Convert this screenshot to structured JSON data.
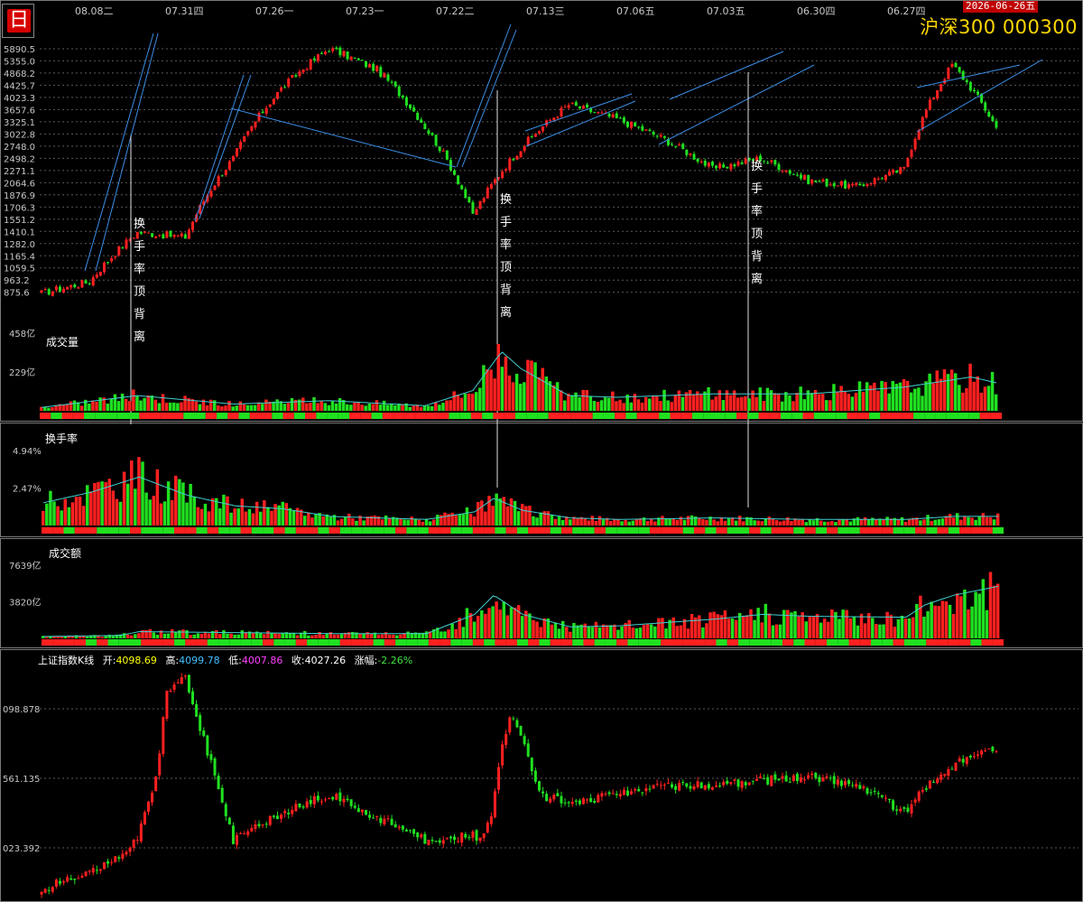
{
  "header": {
    "period_button": "日",
    "title": "沪深300  000300",
    "date_badge": "2026-06-26五"
  },
  "colors": {
    "up": "#ff2020",
    "down": "#20e020",
    "title": "#ffd700",
    "trendline": "#3a8ee6",
    "axis_text": "#c8c8c8",
    "grid": "#5a5a5a"
  },
  "top_dates": [
    "08.08二",
    "07.31四",
    "07.26一",
    "07.23一",
    "07.22二",
    "07.13三",
    "07.06五",
    "07.03五",
    "06.30四",
    "06.27四"
  ],
  "chart_data": [
    {
      "type": "line",
      "name": "price-panel",
      "yscale": "log",
      "ylabels": [
        "5890.5",
        "5355.0",
        "4868.2",
        "4425.7",
        "4023.3",
        "3657.6",
        "3325.1",
        "3022.8",
        "2748.0",
        "2498.2",
        "2271.1",
        "2064.6",
        "1876.9",
        "1706.3",
        "1551.2",
        "1410.1",
        "1282.0",
        "1165.4",
        "1059.5",
        "963.2",
        "875.6"
      ],
      "ylim": [
        820,
        6100
      ],
      "x": [
        0,
        5,
        10,
        15,
        20,
        25,
        30,
        35,
        40,
        45,
        50,
        55,
        60,
        65,
        70,
        75,
        80,
        85,
        90,
        95,
        100
      ],
      "values": [
        870,
        950,
        1400,
        1350,
        2500,
        4300,
        5900,
        5000,
        3200,
        1600,
        2700,
        3800,
        3400,
        2900,
        2300,
        2500,
        2100,
        2000,
        2300,
        5200,
        3000
      ],
      "annotations": [
        "换手率顶背离",
        "换手率顶背离",
        "换手率顶背离"
      ]
    },
    {
      "type": "bar",
      "name": "volume-panel",
      "title": "成交量",
      "ylabels": [
        "458亿",
        "229亿"
      ],
      "ylim": [
        0,
        560
      ]
    },
    {
      "type": "bar",
      "name": "turnover-panel",
      "title": "换手率",
      "ylabels": [
        "4.94%",
        "2.47%"
      ],
      "ylim": [
        0,
        6.2
      ]
    },
    {
      "type": "bar",
      "name": "amount-panel",
      "title": "成交额",
      "ylabels": [
        "7639亿",
        "3820亿"
      ],
      "ylim": [
        0,
        9600
      ]
    },
    {
      "type": "line",
      "name": "index-panel",
      "title": "上证指数K线",
      "ylabels": [
        "098.878",
        "561.135",
        "023.392"
      ]
    }
  ],
  "index_legend": {
    "name": "上证指数K线",
    "open_label": "开:",
    "open_value": "4098.69",
    "high_label": "高:",
    "high_value": "4099.78",
    "low_label": "低:",
    "low_value": "4007.86",
    "close_label": "收:",
    "close_value": "4027.26",
    "change_label": "涨幅:",
    "change_value": "-2.26%"
  },
  "legend_colors": {
    "name": "#ffffff",
    "open": "#ffff00",
    "high": "#40c0ff",
    "low": "#ff40ff",
    "close": "#ffffff",
    "change": "#40e040"
  }
}
